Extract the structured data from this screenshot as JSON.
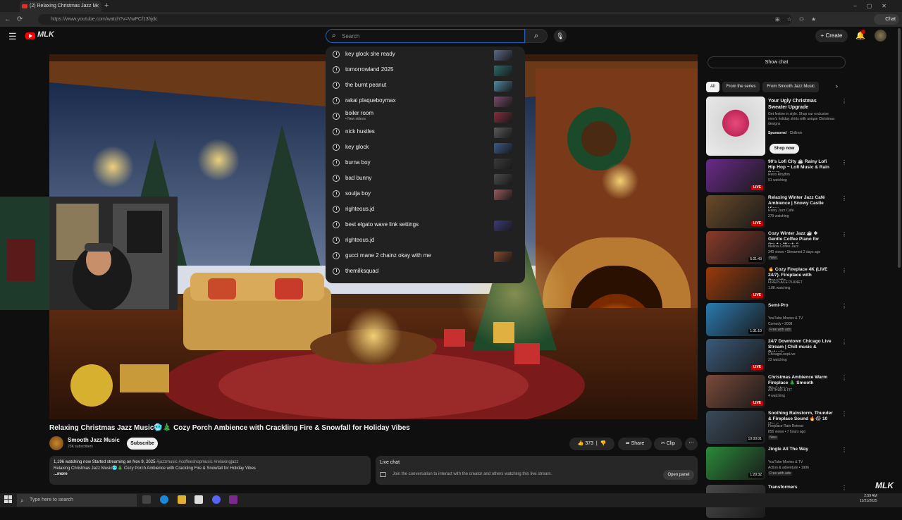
{
  "browser": {
    "tab_title": "(2) Relaxing Christmas Jazz M",
    "url": "https://www.youtube.com/watch?v=VwPCf13hjdc",
    "chat_label": "Chat"
  },
  "header": {
    "brand": "MLK",
    "search_placeholder": "Search",
    "create_label": "Create"
  },
  "search_suggestions": [
    {
      "text": "key glock she ready",
      "thumb": "#5a6a8a"
    },
    {
      "text": "tomorrowland 2025",
      "thumb": "#2a6a6a"
    },
    {
      "text": "the burnt peanut",
      "thumb": "#4a8aa0"
    },
    {
      "text": "rakai plaqueboymax",
      "thumb": "#7a4a6a"
    },
    {
      "text": "boiler room",
      "sub": "• New videos",
      "thumb": "#8a2a3a"
    },
    {
      "text": "nick hustles",
      "thumb": "#5a5a5a"
    },
    {
      "text": "key glock",
      "thumb": "#3a5a8a"
    },
    {
      "text": "burna boy",
      "thumb": "#3a3a3a"
    },
    {
      "text": "bad bunny",
      "thumb": "#4a4a4a"
    },
    {
      "text": "soulja boy",
      "thumb": "#9a5a5a"
    },
    {
      "text": "righteous.jd",
      "thumb": ""
    },
    {
      "text": "best elgato wave link settings",
      "thumb": "#3a3a7a"
    },
    {
      "text": "righteous.jd",
      "thumb": ""
    },
    {
      "text": "gucci mane 2 chainz okay with me",
      "thumb": "#8a4a2a"
    },
    {
      "text": "themilksquad",
      "thumb": ""
    }
  ],
  "video": {
    "title": "Relaxing Christmas Jazz Music🥶🎄 Cozy Porch Ambience with Crackling Fire & Snowfall for Holiday Vibes",
    "channel": "Smooth Jazz Music",
    "subscribers": "23K subscribers",
    "subscribe_label": "Subscribe",
    "likes": "373",
    "share_label": "Share",
    "clip_label": "Clip",
    "desc_stats": "1,196 watching now  Started streaming on Nov 9, 2025",
    "desc_tags": "#jazzmusic #coffeeshopmusic #relaxingjazz",
    "desc_line2": "Relaxing Christmas Jazz Music🥶🎄 Cozy Porch Ambience with Crackling Fire & Snowfall for Holiday Vibes",
    "desc_more": "...more"
  },
  "live_chat": {
    "title": "Live chat",
    "message": "Join the conversation to interact with the creator and others watching this live stream.",
    "open_label": "Open panel"
  },
  "sidebar": {
    "show_chat": "Show chat",
    "chips": [
      "All",
      "From the series",
      "From Smooth Jazz Music"
    ],
    "ad": {
      "title": "Your Ugly Christmas Sweater Upgrade",
      "desc": "Get festive in style. Shop our exclusive men's holiday shirts with unique Christmas designs",
      "sponsored": "Sponsored",
      "advertiser": "· Chillmin",
      "cta": "Shop now"
    },
    "recommendations": [
      {
        "title": "90's Lofi City ☕ Rainy Lofi Hip Hop ~ Lofi Music & Rain Soun...",
        "channel": "Retro Rhythm",
        "views": "91 watching",
        "badge": "LIVE",
        "color": "#6a2a8a"
      },
      {
        "title": "Relaxing Winter Jazz Café Ambience | Snowy Castle View...",
        "channel": "Rainy Jazz Café",
        "views": "279 watching",
        "badge": "LIVE",
        "color": "#6a4a2a"
      },
      {
        "title": "Cozy Winter Jazz ☕ ❄ Gentle Coffee Piano for Study, Work &...",
        "channel": "Mellow Coffee Jazz",
        "views": "340 views • Streamed 2 days ago",
        "extra": "New",
        "duration": "5:21:43",
        "color": "#8a3a2a"
      },
      {
        "title": "🔥 Cozy Fireplace 4K (LIVE 24/7). Fireplace with Cracklin...",
        "channel": "FIREPLACE PLANET",
        "views": "1.8K watching",
        "badge": "LIVE",
        "color": "#9a3a0a"
      },
      {
        "title": "Semi-Pro",
        "channel": "YouTube Movies & TV",
        "views": "Comedy • 2008",
        "extra": "Free with ads",
        "duration": "1:31:10",
        "color": "#2a7ab0"
      },
      {
        "title": "24/7 Downtown Chicago Live Stream | Chill music & Relaxin...",
        "channel": "ChicagoLoopLive",
        "views": "23 watching",
        "badge": "LIVE",
        "color": "#3a5a7a"
      },
      {
        "title": "Christmas Ambience Warm Fireplace 🎄 Smooth Christma...",
        "channel": "ARTHUR & FIT",
        "views": "4 watching",
        "badge": "LIVE",
        "color": "#7a4a3a"
      },
      {
        "title": "Soothing Rainstorm, Thunder & Fireplace Sound 🔥🌧 10 Hour...",
        "channel": "Fireplace Rain Retreat",
        "views": "856 views • 7 hours ago",
        "extra": "New",
        "duration": "10:00:01",
        "color": "#3a4a5a"
      },
      {
        "title": "Jingle All The Way",
        "channel": "YouTube Movies & TV",
        "views": "Action & adventure • 1996",
        "extra": "Free with ads",
        "duration": "1:29:32",
        "color": "#2a8a3a"
      },
      {
        "title": "Transformers",
        "channel": "",
        "views": "",
        "color": "#4a4a4a"
      }
    ]
  },
  "taskbar": {
    "search_placeholder": "Type here to search",
    "time": "2:59 AM",
    "date": "11/21/2025"
  },
  "watermark": "MLK"
}
